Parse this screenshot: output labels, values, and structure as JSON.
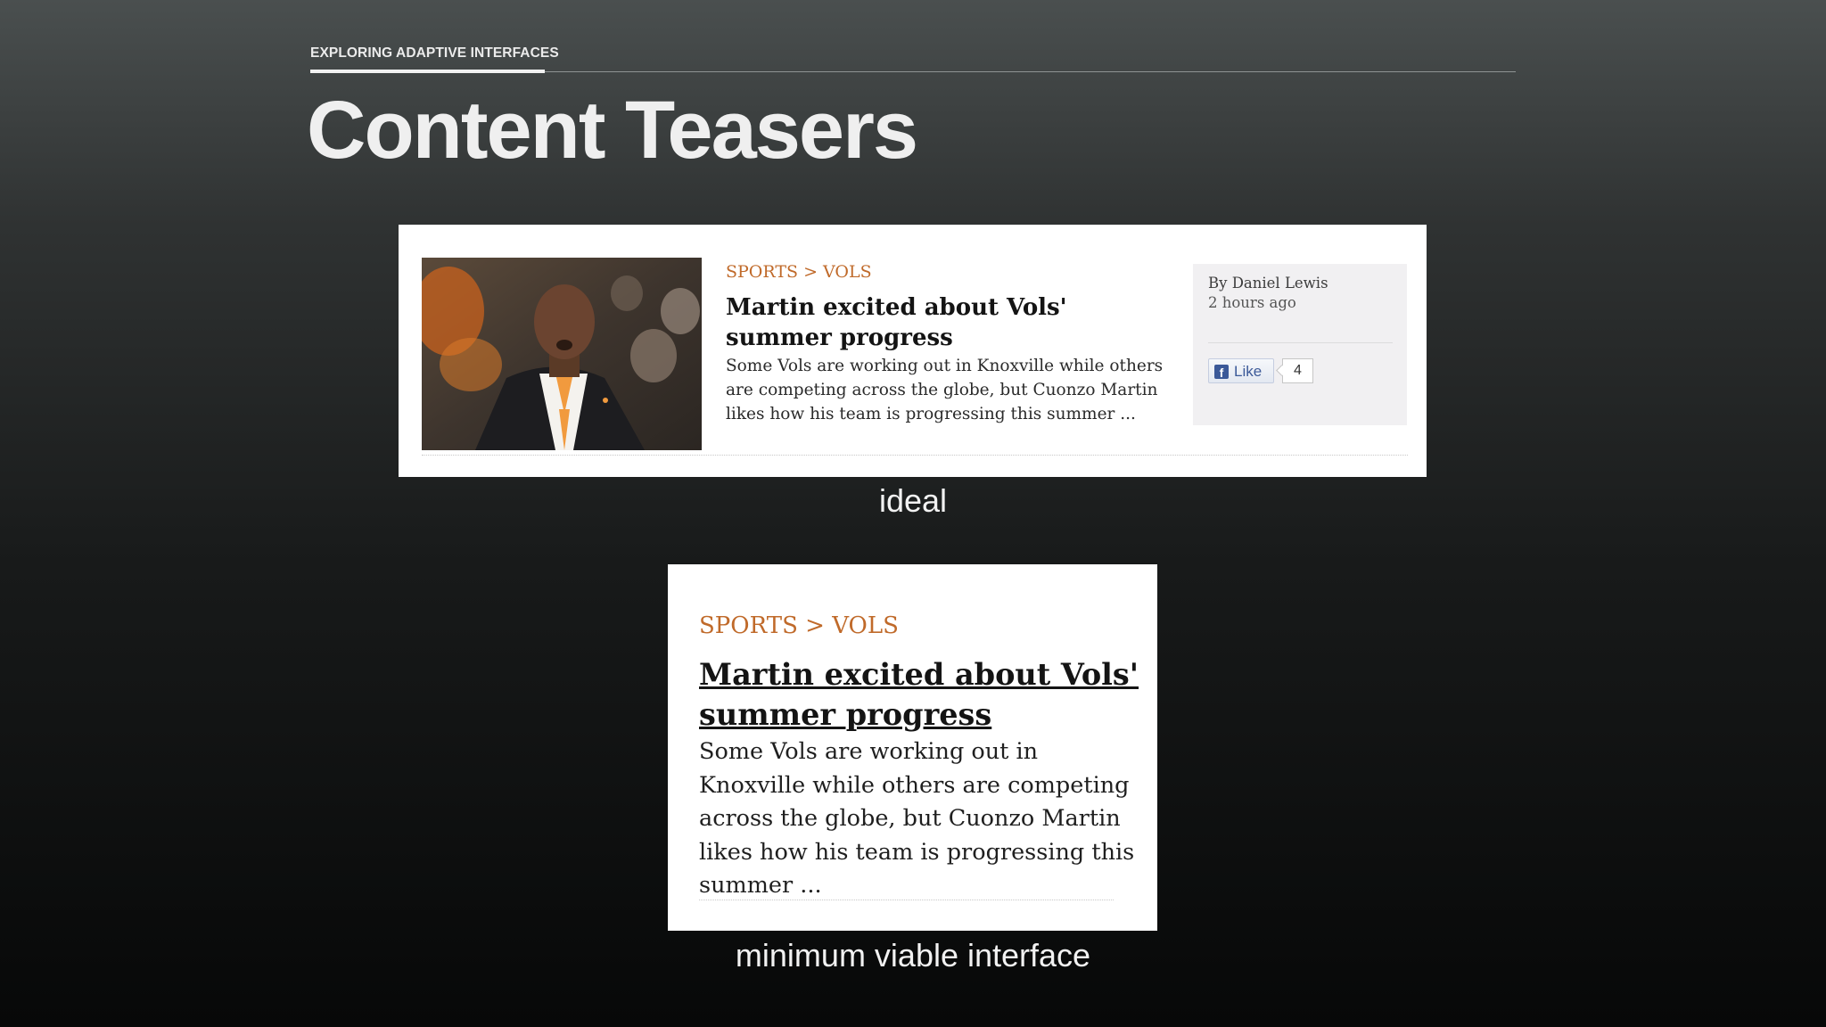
{
  "slide": {
    "kicker": "EXPLORING ADAPTIVE INTERFACES",
    "title": "Content Teasers"
  },
  "ideal": {
    "caption": "ideal",
    "category": "SPORTS > VOLS",
    "headline": "Martin excited about Vols' summer progress",
    "summary": "Some Vols are working out in Knoxville while others are competing across the globe, but Cuonzo Martin likes how his team is progressing this summer ...",
    "byline": "By Daniel Lewis",
    "timestamp": "2 hours ago",
    "like_label": "Like",
    "like_count": "4",
    "photo_icon": "coach-photo"
  },
  "minimum": {
    "caption": "minimum viable interface",
    "category": "SPORTS > VOLS",
    "headline": "Martin excited about Vols' summer progress",
    "summary": "Some Vols are working out in Knoxville while others are competing across the globe, but Cuonzo Martin likes how his team is progressing this summer ..."
  },
  "colors": {
    "category": "#c06a2a",
    "facebook": "#3b5998",
    "background_top": "#4a4f4f",
    "background_bottom": "#070808"
  }
}
